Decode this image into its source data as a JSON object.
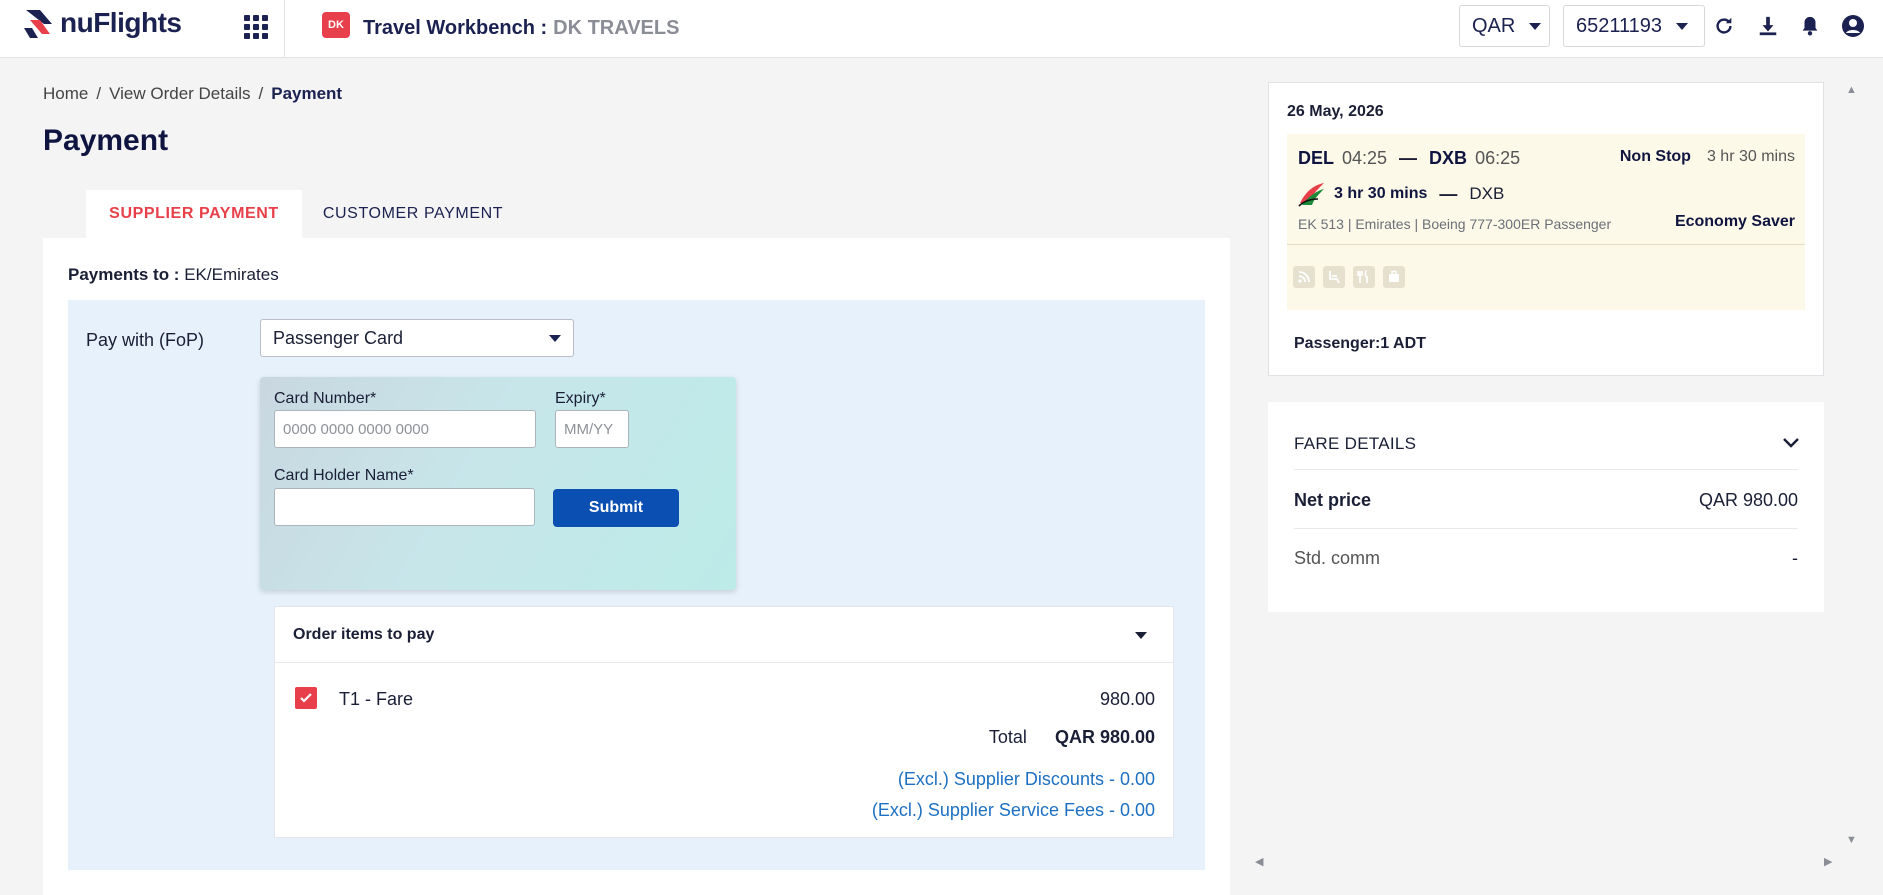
{
  "header": {
    "logo_text": "nuFlights",
    "workbench_title": "Travel Workbench :",
    "workbench_agency": "DK TRAVELS",
    "currency": "QAR",
    "account_id": "65211193",
    "icons": [
      "apps-grid-icon",
      "refresh-icon",
      "download-icon",
      "bell-icon",
      "user-icon"
    ]
  },
  "breadcrumb": {
    "items": [
      "Home",
      "View Order Details",
      "Payment"
    ],
    "separator": "/"
  },
  "page": {
    "title": "Payment"
  },
  "tabs": [
    {
      "label": "SUPPLIER PAYMENT",
      "active": true
    },
    {
      "label": "CUSTOMER PAYMENT",
      "active": false
    }
  ],
  "payment": {
    "payments_to_label": "Payments to :",
    "payments_to_value": "EK/Emirates",
    "fop_label": "Pay with (FoP)",
    "fop_selected": "Passenger Card",
    "card": {
      "number_label": "Card Number*",
      "number_placeholder": "0000 0000 0000 0000",
      "expiry_label": "Expiry*",
      "expiry_placeholder": "MM/YY",
      "holder_label": "Card Holder Name*",
      "holder_value": "",
      "submit_label": "Submit"
    },
    "order": {
      "title": "Order items to pay",
      "items": [
        {
          "label": "T1 - Fare",
          "amount": "980.00",
          "checked": true
        }
      ],
      "total_label": "Total",
      "total_value": "QAR 980.00",
      "excl_discounts": "(Excl.) Supplier Discounts - 0.00",
      "excl_fees": "(Excl.) Supplier Service Fees - 0.00"
    }
  },
  "flight": {
    "date": "26 May, 2026",
    "origin": "DEL",
    "dep_time": "04:25",
    "destination": "DXB",
    "arr_time": "06:25",
    "stops": "Non Stop",
    "duration_top": "3 hr 30 mins",
    "duration": "3 hr 30 mins",
    "segment_dest": "DXB",
    "meta": "EK 513 | Emirates | Boeing 777-300ER Passenger",
    "fare_class": "Economy Saver",
    "passenger": "Passenger:1 ADT",
    "amenities": [
      "wifi-icon",
      "seat-icon",
      "meal-icon",
      "baggage-icon"
    ]
  },
  "fare_details": {
    "title": "FARE DETAILS",
    "rows": [
      {
        "label": "Net price",
        "value": "QAR 980.00"
      },
      {
        "label": "Std. comm",
        "value": "-"
      }
    ]
  },
  "colors": {
    "brand_red": "#e8404a",
    "navy": "#1b2150",
    "submit_blue": "#0b4fb3",
    "link_blue": "#1d70c2",
    "panel_blue": "#e7f1fb",
    "flight_bg": "#fdf9e8"
  }
}
